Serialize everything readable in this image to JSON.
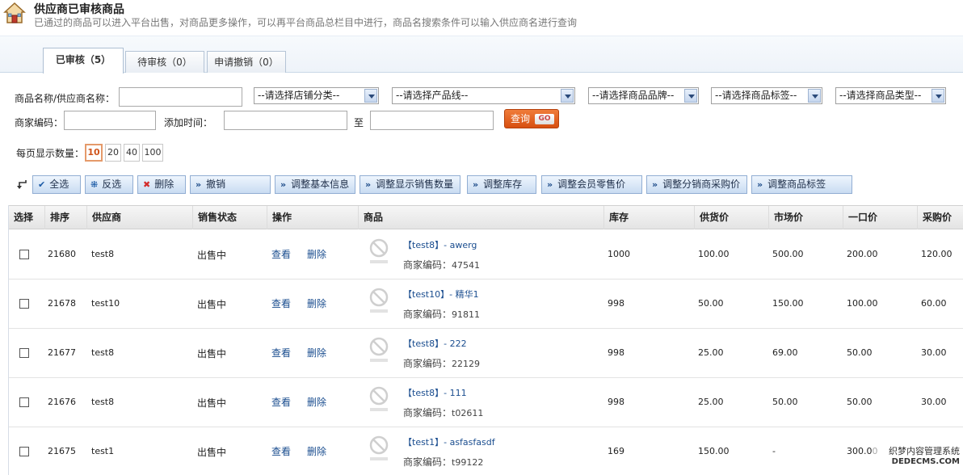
{
  "header": {
    "title": "供应商已审核商品",
    "description": "已通过的商品可以进入平台出售，对商品更多操作，可以再平台商品总栏目中进行，商品名搜索条件可以输入供应商名进行查询"
  },
  "tabs": [
    {
      "label": "已审核（5）",
      "active": true
    },
    {
      "label": "待审核（0）",
      "active": false
    },
    {
      "label": "申请撤销（0）",
      "active": false
    }
  ],
  "filters": {
    "name_label": "商品名称/供应商名称：",
    "name_value": "",
    "shop_category": "--请选择店铺分类--",
    "product_line": "--请选择产品线--",
    "brand": "--请选择商品品牌--",
    "tag": "--请选择商品标签--",
    "product_type": "--请选择商品类型--",
    "code_label": "商家编码：",
    "code_value": "",
    "time_label": "添加时间：",
    "time_from": "",
    "to_label": "至",
    "time_to": "",
    "query_label": "查询",
    "query_go": "GO"
  },
  "pagesize": {
    "label": "每页显示数量：",
    "options": [
      "10",
      "20",
      "40",
      "100"
    ],
    "selected": "10"
  },
  "actions": {
    "select_all": "全选",
    "invert": "反选",
    "delete": "删除",
    "revoke": "撤销",
    "adjust_basic": "调整基本信息",
    "adjust_sales": "调整显示销售数量",
    "adjust_stock": "调整库存",
    "adjust_member_price": "调整会员零售价",
    "adjust_distributor_price": "调整分销商采购价",
    "adjust_tags": "调整商品标签"
  },
  "table": {
    "columns": [
      "选择",
      "排序",
      "供应商",
      "销售状态",
      "操作",
      "商品",
      "库存",
      "供货价",
      "市场价",
      "一口价",
      "采购价"
    ],
    "view_label": "查看",
    "delete_label": "删除",
    "code_prefix": "商家编码：",
    "rows": [
      {
        "sort": "21680",
        "supplier": "test8",
        "status": "出售中",
        "product": "【test8】- awerg",
        "code": "47541",
        "stock": "1000",
        "supply_price": "100.00",
        "market_price": "500.00",
        "fixed_price": "200.00",
        "purchase_price": "120.00"
      },
      {
        "sort": "21678",
        "supplier": "test10",
        "status": "出售中",
        "product": "【test10】- 精华1",
        "code": "91811",
        "stock": "998",
        "supply_price": "50.00",
        "market_price": "150.00",
        "fixed_price": "100.00",
        "purchase_price": "60.00"
      },
      {
        "sort": "21677",
        "supplier": "test8",
        "status": "出售中",
        "product": "【test8】- 222",
        "code": "22129",
        "stock": "998",
        "supply_price": "25.00",
        "market_price": "69.00",
        "fixed_price": "50.00",
        "purchase_price": "30.00"
      },
      {
        "sort": "21676",
        "supplier": "test8",
        "status": "出售中",
        "product": "【test8】- 111",
        "code": "t02611",
        "stock": "998",
        "supply_price": "25.00",
        "market_price": "50.00",
        "fixed_price": "50.00",
        "purchase_price": "30.00"
      },
      {
        "sort": "21675",
        "supplier": "test1",
        "status": "出售中",
        "product": "【test1】- asfasfasdf",
        "code": "t99122",
        "stock": "169",
        "supply_price": "150.00",
        "market_price": "-",
        "fixed_price": "300.00",
        "purchase_price": ""
      }
    ]
  },
  "watermark": {
    "line1": "织梦内容管理系统",
    "line2": "DEDECMS.COM"
  }
}
